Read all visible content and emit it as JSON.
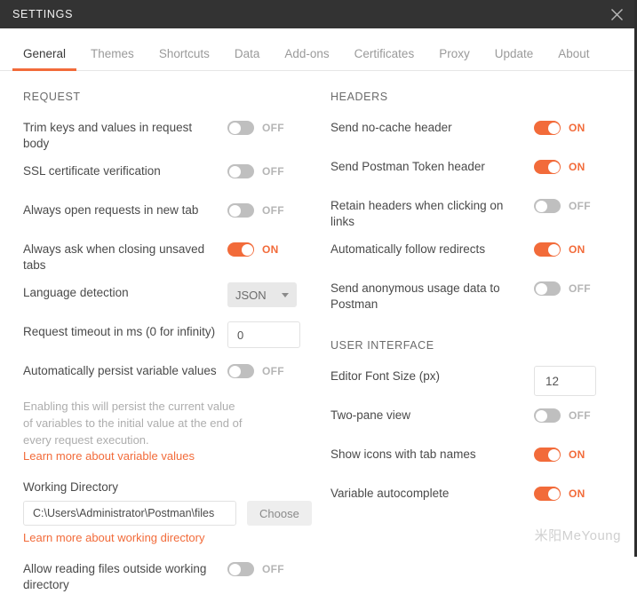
{
  "window": {
    "title": "SETTINGS",
    "close_icon": "close-icon"
  },
  "tabs": [
    {
      "label": "General",
      "active": true
    },
    {
      "label": "Themes",
      "active": false
    },
    {
      "label": "Shortcuts",
      "active": false
    },
    {
      "label": "Data",
      "active": false
    },
    {
      "label": "Add-ons",
      "active": false
    },
    {
      "label": "Certificates",
      "active": false
    },
    {
      "label": "Proxy",
      "active": false
    },
    {
      "label": "Update",
      "active": false
    },
    {
      "label": "About",
      "active": false
    }
  ],
  "colors": {
    "accent": "#f26b3a",
    "titlebar": "#333333",
    "toggle_off": "#bfbfbf",
    "label": "#4a4a4a",
    "muted": "#adadad"
  },
  "left": {
    "section_title": "REQUEST",
    "rows": [
      {
        "label": "Trim keys and values in request body",
        "state": "OFF",
        "on": false
      },
      {
        "label": "SSL certificate verification",
        "state": "OFF",
        "on": false
      },
      {
        "label": "Always open requests in new tab",
        "state": "OFF",
        "on": false
      },
      {
        "label": "Always ask when closing unsaved tabs",
        "state": "ON",
        "on": true
      }
    ],
    "language_detection": {
      "label": "Language detection",
      "value": "JSON"
    },
    "request_timeout": {
      "label": "Request timeout in ms (0 for infinity)",
      "value": "0"
    },
    "persist_variables": {
      "label": "Automatically persist variable values",
      "state": "OFF",
      "on": false,
      "description": "Enabling this will persist the current value of variables to the initial value at the end of every request execution.",
      "link": "Learn more about variable values"
    },
    "working_directory": {
      "label": "Working Directory",
      "value": "C:\\Users\\Administrator\\Postman\\files",
      "placeholder": "C:\\Users\\Administrator\\Postman\\files",
      "choose_button": "Choose",
      "link": "Learn more about working directory"
    },
    "allow_outside": {
      "label": "Allow reading files outside working directory",
      "state": "OFF",
      "on": false
    }
  },
  "right": {
    "headers": {
      "section_title": "HEADERS",
      "rows": [
        {
          "label": "Send no-cache header",
          "state": "ON",
          "on": true
        },
        {
          "label": "Send Postman Token header",
          "state": "ON",
          "on": true
        },
        {
          "label": "Retain headers when clicking on links",
          "state": "OFF",
          "on": false
        },
        {
          "label": "Automatically follow redirects",
          "state": "ON",
          "on": true
        },
        {
          "label": "Send anonymous usage data to Postman",
          "state": "OFF",
          "on": false
        }
      ]
    },
    "user_interface": {
      "section_title": "USER INTERFACE",
      "editor_font_size": {
        "label": "Editor Font Size (px)",
        "value": "12"
      },
      "rows": [
        {
          "label": "Two-pane view",
          "state": "OFF",
          "on": false
        },
        {
          "label": "Show icons with tab names",
          "state": "ON",
          "on": true
        },
        {
          "label": "Variable autocomplete",
          "state": "ON",
          "on": true
        }
      ]
    }
  },
  "watermark": "米阳MeYoung"
}
